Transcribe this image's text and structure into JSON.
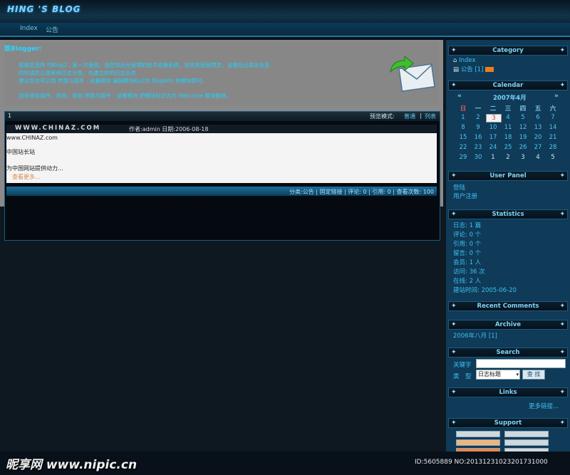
{
  "site": {
    "title": "HING 'S BLOG"
  },
  "nav": {
    "index": "Index",
    "notice": "公告"
  },
  "announce": {
    "greeting": "致Blogger:",
    "lines": [
      "感谢您选择 PJBlog2 , 第一次使用，请您到后台管理的账号设置系统，修改系统管理员，设置站点基本信息",
      "同时请您认真审阅日志分类，先建立你的日志分类",
      "建议您也可以到 界面与插件 - 设置模块 编辑模块标识为 BlogInfo 的模块即可。",
      "因有使用插件，修改：请到 界面与插件 - 设置模块 把模块标识为为 Welcome 模块删除。"
    ]
  },
  "post": {
    "page_number": "1",
    "view_mode_label": "预览模式:",
    "view_mode_normal": "普通",
    "view_mode_list": "列表",
    "title": "WWW.CHINAZ.COM",
    "meta": "作者:admin 日期:2006-08-18",
    "body": [
      "www.CHINAZ.com",
      "中国站长站",
      "为中国网站提供动力..."
    ],
    "more": "查看更多...",
    "footer": "分类:公告 | 固定链接 | 评论: 0 | 引用: 0 | 查看次数: 100"
  },
  "sidebar": {
    "category": {
      "title": "Category",
      "items": [
        {
          "label": "Index"
        },
        {
          "label": "公告 [1]"
        }
      ]
    },
    "calendar": {
      "title": "Calendar",
      "month": "2007年4月",
      "weekdays": [
        "日",
        "一",
        "二",
        "三",
        "四",
        "五",
        "六"
      ],
      "weeks": [
        [
          "1",
          "2",
          "3",
          "4",
          "5",
          "6",
          "7"
        ],
        [
          "8",
          "9",
          "10",
          "11",
          "12",
          "13",
          "14"
        ],
        [
          "15",
          "16",
          "17",
          "18",
          "19",
          "20",
          "21"
        ],
        [
          "22",
          "23",
          "24",
          "25",
          "26",
          "27",
          "28"
        ],
        [
          "29",
          "30",
          "1",
          "2",
          "3",
          "4",
          "5"
        ]
      ]
    },
    "user_panel": {
      "title": "User Panel",
      "items": [
        "登陆",
        "用户注册"
      ]
    },
    "statistics": {
      "title": "Statistics",
      "items": [
        "日志: 1 篇",
        "评论: 0 个",
        "引用: 0 个",
        "留言: 0 个",
        "会员: 1 人",
        "访问: 36 次",
        "在线: 2 人",
        "建站时间: 2005-06-20"
      ]
    },
    "recent_comments": {
      "title": "Recent Comments"
    },
    "archive": {
      "title": "Archive",
      "items": [
        "2006年八月 [1]"
      ]
    },
    "search": {
      "title": "Search",
      "keyword_label": "关键字",
      "type_label": "类　型",
      "select_value": "日志标题",
      "button": "查 找"
    },
    "links": {
      "title": "Links",
      "more": "更多链接..."
    },
    "support": {
      "title": "Support"
    }
  },
  "watermark": {
    "text": "昵享网 www.nipic.cn",
    "id": "ID:5605889 NO:20131231023201731000"
  },
  "colors": {
    "accent": "#1fd2ff",
    "sidebar_bg": "#0f3a58",
    "calendar_today": "#c23e45"
  }
}
